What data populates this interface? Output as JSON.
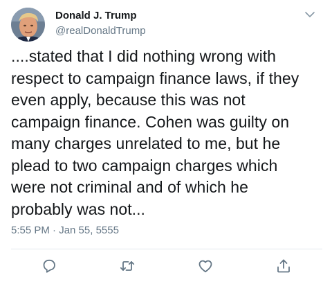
{
  "author": {
    "display_name": "Donald J. Trump",
    "handle": "@realDonaldTrump",
    "avatar": "profile-photo"
  },
  "tweet": {
    "text_lines": [
      "....stated that I did nothing wrong with",
      "respect to campaign finance laws, if they",
      "even apply, because this was not",
      "campaign finance. Cohen was guilty on",
      "many charges unrelated to me, but he",
      "plead to two campaign charges which",
      "were not criminal and of which he",
      "probably was not..."
    ],
    "timestamp": "5:55 PM · Jan 55, 5555"
  },
  "actions": [
    {
      "name": "reply",
      "icon": "reply-icon"
    },
    {
      "name": "retweet",
      "icon": "retweet-icon"
    },
    {
      "name": "like",
      "icon": "heart-icon"
    },
    {
      "name": "share",
      "icon": "share-icon"
    }
  ],
  "colors": {
    "text": "#14171a",
    "secondary": "#657786",
    "icon": "#657786",
    "divider": "#e1e8ed"
  }
}
